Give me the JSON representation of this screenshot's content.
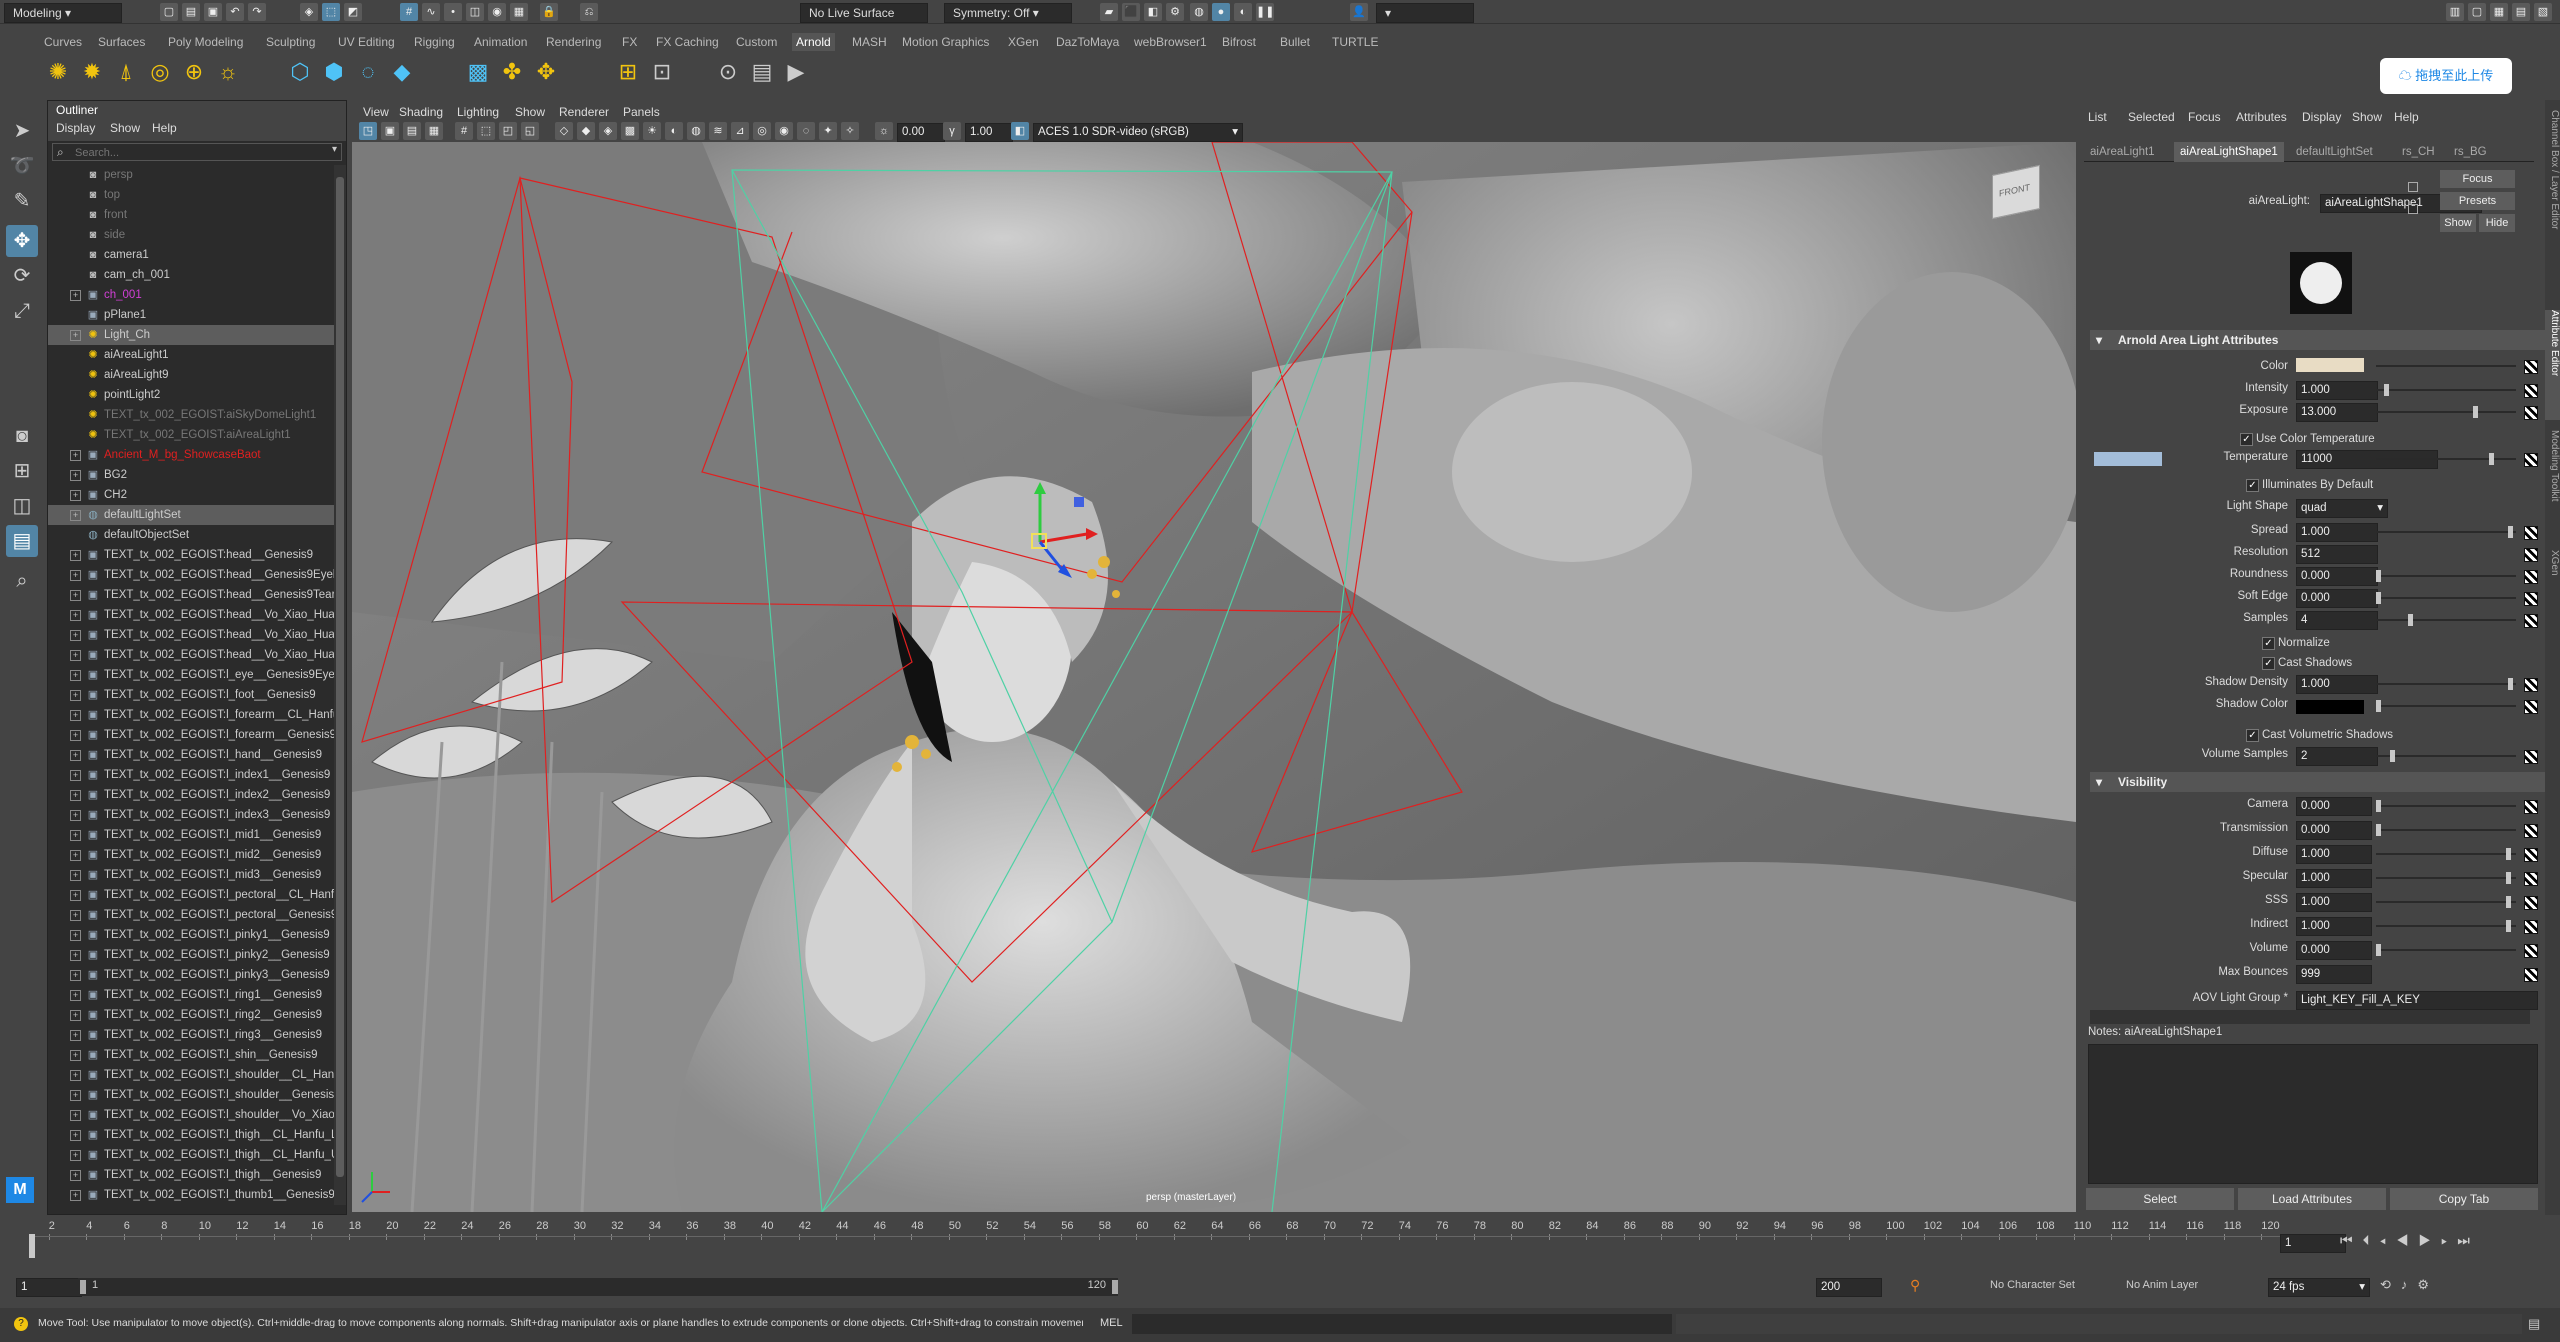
{
  "status_line": {
    "menu_set": "Modeling",
    "live_surface": "No Live Surface",
    "symmetry": "Symmetry: Off"
  },
  "shelf_tabs": [
    "Curves",
    "Surfaces",
    "Poly Modeling",
    "Sculpting",
    "UV Editing",
    "Rigging",
    "Animation",
    "Rendering",
    "FX",
    "FX Caching",
    "Custom",
    "Arnold",
    "MASH",
    "Motion Graphics",
    "XGen",
    "DazToMaya",
    "webBrowser1",
    "Bifrost",
    "Bullet",
    "TURTLE"
  ],
  "active_shelf_tab": "Arnold",
  "upload_badge": "拖拽至此上传",
  "outliner": {
    "title": "Outliner",
    "menu": [
      "Display",
      "Show",
      "Help"
    ],
    "search_placeholder": "Search...",
    "items": [
      {
        "label": "persp",
        "dim": true
      },
      {
        "label": "top",
        "dim": true
      },
      {
        "label": "front",
        "dim": true
      },
      {
        "label": "side",
        "dim": true
      },
      {
        "label": "camera1"
      },
      {
        "label": "cam_ch_001"
      },
      {
        "label": "ch_001",
        "color": "#d13fd6",
        "exp": true
      },
      {
        "label": "pPlane1"
      },
      {
        "label": "Light_Ch",
        "exp": true,
        "sel": true
      },
      {
        "label": "aiAreaLight1"
      },
      {
        "label": "aiAreaLight9"
      },
      {
        "label": "pointLight2"
      },
      {
        "label": "TEXT_tx_002_EGOIST:aiSkyDomeLight1",
        "dim": true
      },
      {
        "label": "TEXT_tx_002_EGOIST:aiAreaLight1",
        "dim": true
      },
      {
        "label": "Ancient_M_bg_ShowcaseBaot",
        "color": "#e02020",
        "exp": true
      },
      {
        "label": "BG2",
        "exp": true
      },
      {
        "label": "CH2",
        "exp": true
      },
      {
        "label": "defaultLightSet",
        "exp": true,
        "sel": true
      },
      {
        "label": "defaultObjectSet"
      },
      {
        "label": "TEXT_tx_002_EGOIST:head__Genesis9",
        "exp": true
      },
      {
        "label": "TEXT_tx_002_EGOIST:head__Genesis9Eyelash",
        "exp": true
      },
      {
        "label": "TEXT_tx_002_EGOIST:head__Genesis9Tear",
        "exp": true
      },
      {
        "label": "TEXT_tx_002_EGOIST:head__Vo_Xiao_Hua_Eye",
        "exp": true
      },
      {
        "label": "TEXT_tx_002_EGOIST:head__Vo_Xiao_Hua_Ha",
        "exp": true
      },
      {
        "label": "TEXT_tx_002_EGOIST:head__Vo_Xiao_Hua_Ha",
        "exp": true
      },
      {
        "label": "TEXT_tx_002_EGOIST:l_eye__Genesis9Eyes",
        "exp": true
      },
      {
        "label": "TEXT_tx_002_EGOIST:l_foot__Genesis9",
        "exp": true
      },
      {
        "label": "TEXT_tx_002_EGOIST:l_forearm__CL_Hanfu_U",
        "exp": true
      },
      {
        "label": "TEXT_tx_002_EGOIST:l_forearm__Genesis9",
        "exp": true
      },
      {
        "label": "TEXT_tx_002_EGOIST:l_hand__Genesis9",
        "exp": true
      },
      {
        "label": "TEXT_tx_002_EGOIST:l_index1__Genesis9",
        "exp": true
      },
      {
        "label": "TEXT_tx_002_EGOIST:l_index2__Genesis9",
        "exp": true
      },
      {
        "label": "TEXT_tx_002_EGOIST:l_index3__Genesis9",
        "exp": true
      },
      {
        "label": "TEXT_tx_002_EGOIST:l_mid1__Genesis9",
        "exp": true
      },
      {
        "label": "TEXT_tx_002_EGOIST:l_mid2__Genesis9",
        "exp": true
      },
      {
        "label": "TEXT_tx_002_EGOIST:l_mid3__Genesis9",
        "exp": true
      },
      {
        "label": "TEXT_tx_002_EGOIST:l_pectoral__CL_Hanfu_U",
        "exp": true
      },
      {
        "label": "TEXT_tx_002_EGOIST:l_pectoral__Genesis9",
        "exp": true
      },
      {
        "label": "TEXT_tx_002_EGOIST:l_pinky1__Genesis9",
        "exp": true
      },
      {
        "label": "TEXT_tx_002_EGOIST:l_pinky2__Genesis9",
        "exp": true
      },
      {
        "label": "TEXT_tx_002_EGOIST:l_pinky3__Genesis9",
        "exp": true
      },
      {
        "label": "TEXT_tx_002_EGOIST:l_ring1__Genesis9",
        "exp": true
      },
      {
        "label": "TEXT_tx_002_EGOIST:l_ring2__Genesis9",
        "exp": true
      },
      {
        "label": "TEXT_tx_002_EGOIST:l_ring3__Genesis9",
        "exp": true
      },
      {
        "label": "TEXT_tx_002_EGOIST:l_shin__Genesis9",
        "exp": true
      },
      {
        "label": "TEXT_tx_002_EGOIST:l_shoulder__CL_Hanfu_U",
        "exp": true
      },
      {
        "label": "TEXT_tx_002_EGOIST:l_shoulder__Genesis9",
        "exp": true
      },
      {
        "label": "TEXT_tx_002_EGOIST:l_shoulder__Vo_Xiao_Hu",
        "exp": true
      },
      {
        "label": "TEXT_tx_002_EGOIST:l_thigh__CL_Hanfu_Low",
        "exp": true
      },
      {
        "label": "TEXT_tx_002_EGOIST:l_thigh__CL_Hanfu_Upp",
        "exp": true
      },
      {
        "label": "TEXT_tx_002_EGOIST:l_thigh__Genesis9",
        "exp": true
      },
      {
        "label": "TEXT_tx_002_EGOIST:l_thumb1__Genesis9",
        "exp": true
      }
    ]
  },
  "viewport": {
    "menu": [
      "View",
      "Shading",
      "Lighting",
      "Show",
      "Renderer",
      "Panels"
    ],
    "exposure": "0.00",
    "gamma": "1.00",
    "color_space": "ACES 1.0 SDR-video (sRGB)",
    "camera_label": "persp (masterLayer)",
    "viewcube_label": "FRONT"
  },
  "attribute_editor": {
    "menu": [
      "List",
      "Selected",
      "Focus",
      "Attributes",
      "Display",
      "Show",
      "Help"
    ],
    "tabs": [
      "aiAreaLight1",
      "aiAreaLightShape1",
      "defaultLightSet",
      "rs_CH",
      "rs_BG"
    ],
    "active_tab": "aiAreaLightShape1",
    "node_type_label": "aiAreaLight:",
    "node_name": "aiAreaLightShape1",
    "buttons": {
      "focus": "Focus",
      "presets": "Presets",
      "show": "Show",
      "hide": "Hide"
    },
    "section_main": "Arnold Area Light Attributes",
    "color_label": "Color",
    "light_color": "#e8dcc4",
    "intensity": {
      "label": "Intensity",
      "value": "1.000"
    },
    "exposure": {
      "label": "Exposure",
      "value": "13.000"
    },
    "use_color_temperature": "Use Color Temperature",
    "temperature": {
      "label": "Temperature",
      "value": "11000",
      "swatch": "#a3bdd9"
    },
    "illuminates_by_default": "Illuminates By Default",
    "light_shape": {
      "label": "Light Shape",
      "value": "quad"
    },
    "spread": {
      "label": "Spread",
      "value": "1.000"
    },
    "resolution": {
      "label": "Resolution",
      "value": "512"
    },
    "roundness": {
      "label": "Roundness",
      "value": "0.000"
    },
    "soft_edge": {
      "label": "Soft Edge",
      "value": "0.000"
    },
    "samples": {
      "label": "Samples",
      "value": "4"
    },
    "normalize": "Normalize",
    "cast_shadows": "Cast Shadows",
    "shadow_density": {
      "label": "Shadow Density",
      "value": "1.000"
    },
    "shadow_color": {
      "label": "Shadow Color",
      "value": "#000000"
    },
    "cast_volumetric_shadows": "Cast Volumetric Shadows",
    "volume_samples": {
      "label": "Volume Samples",
      "value": "2"
    },
    "section_visibility": "Visibility",
    "camera": {
      "label": "Camera",
      "value": "0.000"
    },
    "transmission": {
      "label": "Transmission",
      "value": "0.000"
    },
    "diffuse": {
      "label": "Diffuse",
      "value": "1.000"
    },
    "specular": {
      "label": "Specular",
      "value": "1.000"
    },
    "sss": {
      "label": "SSS",
      "value": "1.000"
    },
    "indirect": {
      "label": "Indirect",
      "value": "1.000"
    },
    "volume": {
      "label": "Volume",
      "value": "0.000"
    },
    "max_bounces": {
      "label": "Max Bounces",
      "value": "999"
    },
    "aov_light_group": {
      "label": "AOV Light Group *",
      "value": "Light_KEY_Fill_A_KEY"
    },
    "notes_label": "Notes:  aiAreaLightShape1",
    "bottom_buttons": [
      "Select",
      "Load Attributes",
      "Copy Tab"
    ],
    "side_tabs": [
      "Channel Box / Layer Editor",
      "Attribute Editor",
      "Modeling Toolkit",
      "XGen"
    ]
  },
  "timeline": {
    "ticks": [
      "2",
      "4",
      "6",
      "8",
      "10",
      "12",
      "14",
      "16",
      "18",
      "20",
      "22",
      "24",
      "26",
      "28",
      "30",
      "32",
      "34",
      "36",
      "38",
      "40",
      "42",
      "44",
      "46",
      "48",
      "50",
      "52",
      "54",
      "56",
      "58",
      "60",
      "62",
      "64",
      "66",
      "68",
      "70",
      "72",
      "74",
      "76",
      "78",
      "80",
      "82",
      "84",
      "86",
      "88",
      "90",
      "92",
      "94",
      "96",
      "98",
      "100",
      "102",
      "104",
      "106",
      "108",
      "110",
      "112",
      "114",
      "116",
      "118",
      "120"
    ],
    "current_frame": "1",
    "range_start": "1",
    "range_inner_start": "1",
    "range_inner_end": "120",
    "range_end": "200",
    "character_set": "No Character Set",
    "anim_layer": "No Anim Layer",
    "fps": "24 fps"
  },
  "help_line": "Move Tool: Use manipulator to move object(s). Ctrl+middle-drag to move components along normals. Shift+drag manipulator axis or plane handles to extrude components or clone objects. Ctrl+Shift+drag to constrain movement to a cor",
  "command_line_label": "MEL"
}
